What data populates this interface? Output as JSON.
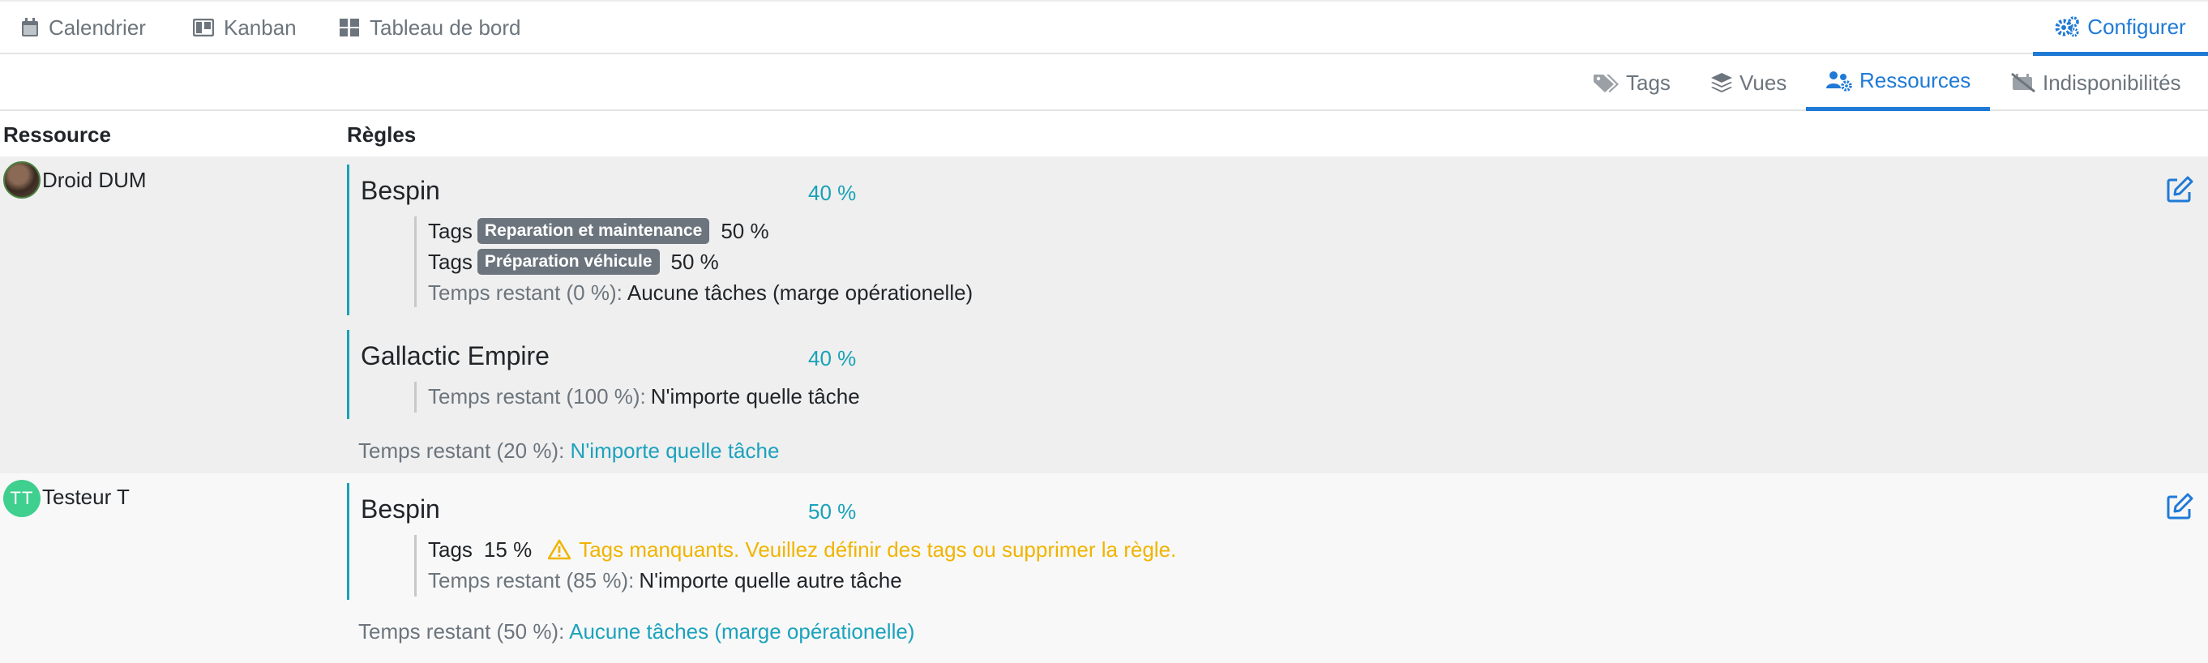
{
  "topnav": {
    "items": [
      {
        "label": "Calendrier",
        "icon": "calendar-icon"
      },
      {
        "label": "Kanban",
        "icon": "kanban-icon"
      },
      {
        "label": "Tableau de bord",
        "icon": "dashboard-icon"
      }
    ],
    "configure_label": "Configurer"
  },
  "subtabs": [
    {
      "label": "Tags",
      "icon": "tags-icon",
      "active": false
    },
    {
      "label": "Vues",
      "icon": "layers-icon",
      "active": false
    },
    {
      "label": "Ressources",
      "icon": "users-gear-icon",
      "active": true
    },
    {
      "label": "Indisponibilités",
      "icon": "unavailable-icon",
      "active": false
    }
  ],
  "table": {
    "headers": {
      "resource": "Ressource",
      "rules": "Règles"
    },
    "rows": [
      {
        "resource": "Droid DUM",
        "avatar": "photo",
        "projects": [
          {
            "name": "Bespin",
            "percent": "40 %",
            "rules": [
              {
                "label": "Tags",
                "tag": "Reparation et maintenance",
                "value": "50 %"
              },
              {
                "label": "Tags",
                "tag": "Préparation véhicule",
                "value": "50 %"
              }
            ],
            "remaining_label": "Temps restant (0 %):",
            "remaining_value": "Aucune tâches (marge opérationelle)"
          },
          {
            "name": "Gallactic Empire",
            "percent": "40 %",
            "rules": [],
            "remaining_label": "Temps restant (100 %):",
            "remaining_value": "N'importe quelle tâche"
          }
        ],
        "remaining_label": "Temps restant (20 %):",
        "remaining_value": "N'importe quelle tâche"
      },
      {
        "resource": "Testeur T",
        "avatar_initials": "TT",
        "projects": [
          {
            "name": "Bespin",
            "percent": "50 %",
            "rules": [
              {
                "label": "Tags",
                "value": "15 %",
                "warning": "Tags manquants. Veuillez définir des tags ou supprimer la règle."
              }
            ],
            "remaining_label": "Temps restant (85 %):",
            "remaining_value": "N'importe quelle autre tâche"
          }
        ],
        "remaining_label": "Temps restant (50 %):",
        "remaining_value": "Aucune tâches (marge opérationelle)"
      }
    ]
  },
  "colors": {
    "accent": "#1f7ad6",
    "teal": "#17a2b8",
    "warning": "#f0b400",
    "badge": "#6c757d",
    "avatar_initials_bg": "#3fcf8e"
  }
}
